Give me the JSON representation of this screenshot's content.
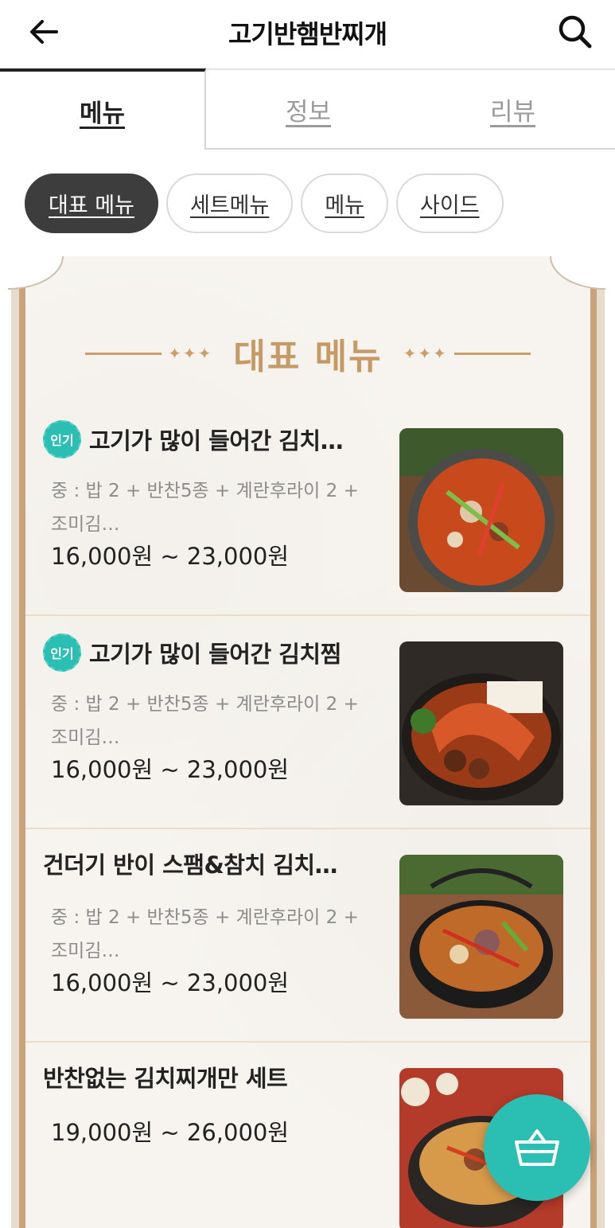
{
  "header": {
    "title": "고기반햄반찌개",
    "back_icon": "arrow-left-icon",
    "search_icon": "search-icon"
  },
  "tabs": [
    {
      "label": "메뉴",
      "active": true
    },
    {
      "label": "정보",
      "active": false
    },
    {
      "label": "리뷰",
      "active": false
    }
  ],
  "chips": [
    {
      "label": "대표 메뉴",
      "active": true
    },
    {
      "label": "세트메뉴",
      "active": false
    },
    {
      "label": "메뉴",
      "active": false
    },
    {
      "label": "사이드",
      "active": false
    }
  ],
  "board": {
    "title": "대표 메뉴",
    "deco": "✦✦✦"
  },
  "items": [
    {
      "badge": "인기",
      "name": "고기가 많이 들어간 김치…",
      "desc_line1": "중 : 밥 2 + 반찬5종 + 계란후라이 2 +",
      "desc_line2": "조미김…",
      "price": "16,000원 ~ 23,000원"
    },
    {
      "badge": "인기",
      "name": "고기가 많이 들어간 김치찜",
      "desc_line1": "중 : 밥 2 + 반찬5종 + 계란후라이 2 +",
      "desc_line2": "조미김…",
      "price": "16,000원 ~ 23,000원"
    },
    {
      "badge": "",
      "name": "건더기 반이 스팸&참치 김치…",
      "desc_line1": "중 : 밥 2 + 반찬5종 + 계란후라이 2 +",
      "desc_line2": "조미김…",
      "price": "16,000원 ~ 23,000원"
    },
    {
      "badge": "",
      "name": "반찬없는 김치찌개만 세트",
      "desc_line1": "",
      "desc_line2": "",
      "price": "19,000원 ~ 26,000원"
    }
  ],
  "cart": {
    "icon": "shopping-basket-icon"
  },
  "colors": {
    "accent": "#2bbfb4",
    "gold": "#c59a66",
    "chip_active": "#3d3d3d"
  }
}
